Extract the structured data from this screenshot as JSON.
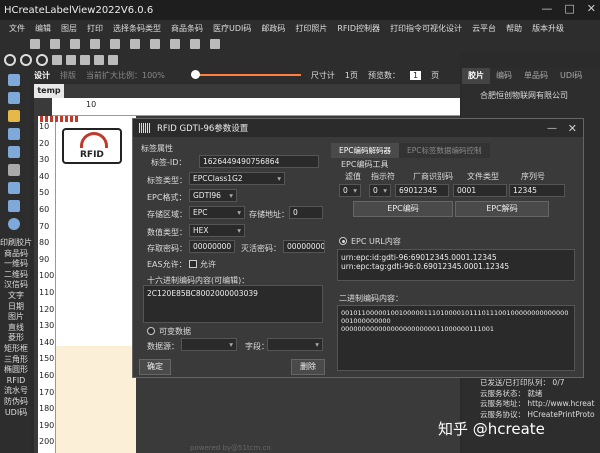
{
  "window": {
    "title": "HCreateLabelView2022V6.0.6",
    "min": "—",
    "max": "□",
    "close": "✕"
  },
  "menu": [
    "文件",
    "编辑",
    "图层",
    "打印",
    "选择条码类型",
    "商品条码",
    "医疗UDI码",
    "邮政码",
    "打印照片",
    "RFID控制器",
    "打印指令可视化设计",
    "云平台",
    "帮助",
    "版本升级"
  ],
  "toolbar3": {
    "design": "设计",
    "layout": "排版",
    "zoom_label": "当前扩大比例：100%",
    "size": "尺寸计",
    "page": "1页",
    "preview": "预览数：",
    "preview_count": "1",
    "page_icon": "页"
  },
  "left_labels": [
    "印刷胶片",
    "商品码",
    "一维码",
    "二维码",
    "汉信码",
    "文字",
    "日期",
    "图片",
    "直线",
    "菱形",
    "矩形框",
    "三角形",
    "椭圆形",
    "RFID",
    "流水号",
    "防伪码",
    "UDI码"
  ],
  "canvas": {
    "tab": "temp",
    "rfid_text": "RFID",
    "ruler_left": [
      "10",
      "20",
      "30",
      "40",
      "50",
      "60",
      "70",
      "80",
      "90",
      "100",
      "110",
      "120",
      "130",
      "140",
      "150",
      "160",
      "170",
      "180",
      "190",
      "200"
    ],
    "ruler_top": [
      "10"
    ],
    "powered": "powered by@51tcm.cn"
  },
  "right_panel": {
    "tabs": [
      "胶片",
      "编码",
      "单品码",
      "UDI码"
    ],
    "company": "合肥恒创物联网有限公司",
    "queue": "已发送/已打印队列：",
    "queue_val": "0/7",
    "status_label": "云服务状态：",
    "status_val": "就绪",
    "addr_label": "云服务地址：",
    "addr_val": "http://www.hcreat",
    "proto_label": "云服务协议：",
    "proto_val": "HCreatePrintProto"
  },
  "watermark": "知乎 @hcreate",
  "dialog": {
    "title": "RFID GDTI-96参数设置",
    "tag_props": "标签属性",
    "tag_id_label": "标签-ID：",
    "tag_id": "1626449490756864",
    "tag_type_label": "标签类型：",
    "tag_type": "EPCClass1G2",
    "epc_format_label": "EPC格式：",
    "epc_format": "GDTI96",
    "storage_label": "存储区域：",
    "storage": "EPC",
    "addr_label": "存储地址：",
    "addr": "0",
    "dtype_label": "数值类型：",
    "dtype": "HEX",
    "access_label": "存取密码：",
    "access": "00000000",
    "kill_label": "灭活密码：",
    "kill": "00000000",
    "eas_label": "EAS允许：",
    "eas_check": "允许",
    "hex_label": "十六进制编码内容(可编辑)：",
    "hex_content": "2C120E85BC8002000003039",
    "var_data": "可变数据",
    "src_label": "数据源：",
    "field_label": "字段：",
    "ok": "确定",
    "delete": "删除",
    "tab_epc": "EPC编码解码器",
    "tab_epc2": "EPC标签数据编码控制",
    "epc_tool": "EPC编码工具",
    "col_filter": "滤值",
    "col_indicator": "指示符",
    "col_factory": "厂商识别码",
    "col_filetype": "文件类型",
    "col_serial": "序列号",
    "v_filter": "0",
    "v_indicator": "0",
    "v_factory": "69012345",
    "v_filetype": "0001",
    "v_serial": "12345",
    "encode_btn": "EPC编码",
    "decode_btn": "EPC解码",
    "uri_label": "EPC URL内容",
    "uri_line1": "urn:epc:id:gdti-96:69012345.0001.12345",
    "uri_line2": "urn:epc:tag:gdti-96:0.69012345.0001.12345",
    "bin_label": "二进制编码内容：",
    "bin_line1": "0010110000010010000011101000010111011100100000000000000001000000000",
    "bin_line2": "0000000000000000000000011000000111001"
  }
}
